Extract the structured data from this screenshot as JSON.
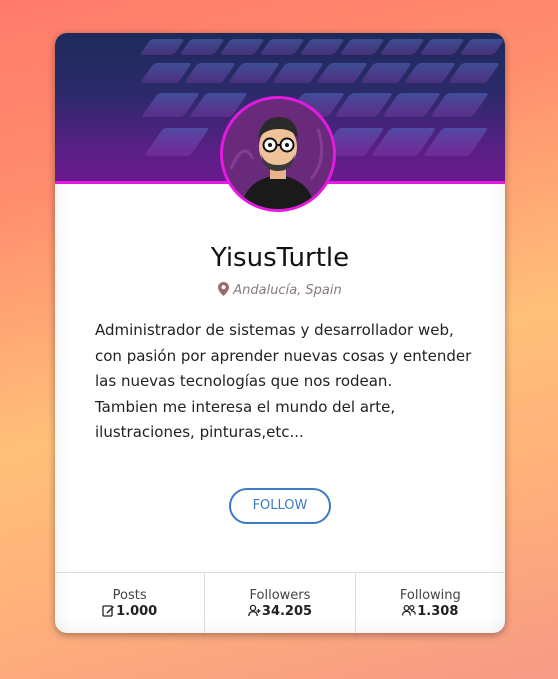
{
  "profile": {
    "name": "YisusTurtle",
    "location": "Andalucía, Spain",
    "bio_lines": [
      "Administrador de sistemas y desarrollador web, con pasión por aprender nuevas cosas y entender las nuevas tecnologías que nos rodean.",
      "Tambien me interesa el mundo del arte, ilustraciones, pinturas,etc..."
    ],
    "follow_label": "FOLLOW"
  },
  "stats": [
    {
      "label": "Posts",
      "value": "1.000",
      "icon": "edit-icon"
    },
    {
      "label": "Followers",
      "value": "34.205",
      "icon": "user-add-icon"
    },
    {
      "label": "Following",
      "value": "1.308",
      "icon": "users-icon"
    }
  ],
  "colors": {
    "accent": "#e51adf",
    "button": "#3b7bc6"
  }
}
